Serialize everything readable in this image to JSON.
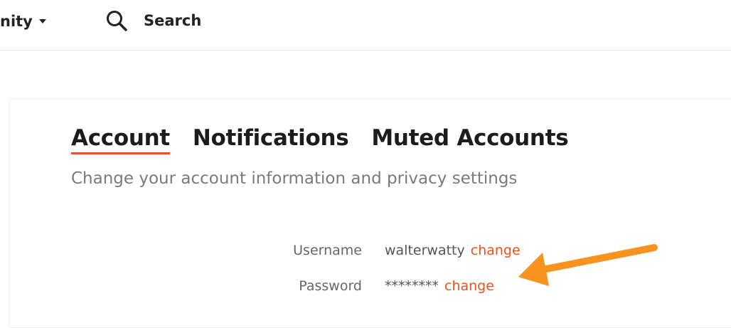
{
  "header": {
    "community_label": "nity",
    "search_label": "Search"
  },
  "settings": {
    "tabs": [
      {
        "label": "Account",
        "active": true
      },
      {
        "label": "Notifications",
        "active": false
      },
      {
        "label": "Muted Accounts",
        "active": false
      }
    ],
    "subtitle": "Change your account information and privacy settings",
    "fields": {
      "username": {
        "label": "Username",
        "value": "walterwatty",
        "action": "change"
      },
      "password": {
        "label": "Password",
        "value": "********",
        "action": "change"
      }
    }
  },
  "colors": {
    "accent": "#e9531a",
    "annotation_arrow": "#f7931e"
  },
  "icons": [
    "search-icon",
    "chevron-down-icon",
    "annotation-arrow"
  ]
}
